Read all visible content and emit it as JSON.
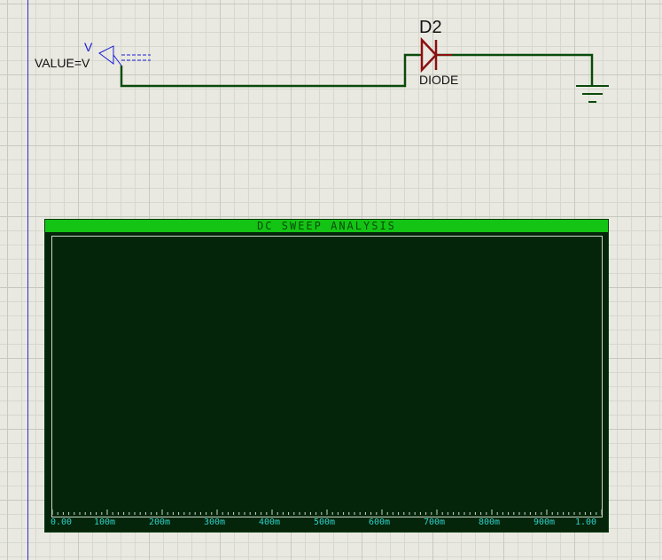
{
  "schematic": {
    "source": {
      "label": "V",
      "value_label": "VALUE=V"
    },
    "diode": {
      "reference": "D2",
      "type_label": "DIODE"
    }
  },
  "graph": {
    "title": "DC SWEEP ANALYSIS",
    "x_ticks": [
      "0.00",
      "100m",
      "200m",
      "300m",
      "400m",
      "500m",
      "600m",
      "700m",
      "800m",
      "900m",
      "1.00"
    ]
  },
  "colors": {
    "wire": "#0b4a0b",
    "component": "#8b1010",
    "label_blue": "#1a1ad6",
    "graph_bg": "#05250a",
    "graph_titlebar": "#14c414",
    "axis_text": "#2fd0c8"
  },
  "icons": {
    "source": "voltage-source-icon",
    "diode": "diode-icon",
    "ground": "ground-icon"
  }
}
